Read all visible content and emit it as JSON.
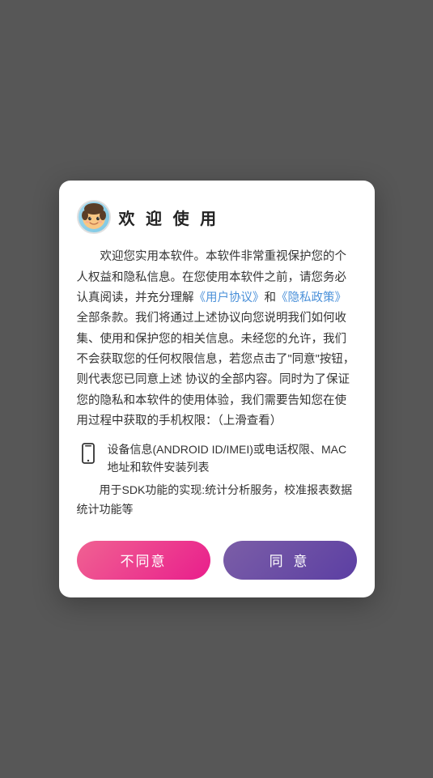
{
  "dialog": {
    "title": "欢 迎 使 用",
    "avatar_alt": "avatar-icon",
    "body_paragraph1": "欢迎您实用本软件。本软件非常重视保护您的个人权益和隐私信息。在您使用本软件之前，请您务必认真阅读，并充分理解",
    "link1": "《用户协议》",
    "body_middle1": "和",
    "link2": "《隐私政策》",
    "body_paragraph2": "全部条款。我们将通过上述协议向您说明我们如何收集、使用和保护您的相关信息。未经您的允许，我们不会获取您的任何权限信息，若您点击了\"同意\"按钮，则代表您已同意上述 协议的全部内容。同时为了保证您的隐私和本软件的使用体验，我们需要告知您在使用过程中获取的手机权限：（上滑查看）",
    "device_info_title": "设备信息(ANDROID ID/IMEI)或电话权限、MAC地址和软件安装列表",
    "sdk_text": "用于SDK功能的实现:统计分析服务，校准报表数据统计功能等",
    "btn_disagree": "不同意",
    "btn_agree": "同 意"
  }
}
